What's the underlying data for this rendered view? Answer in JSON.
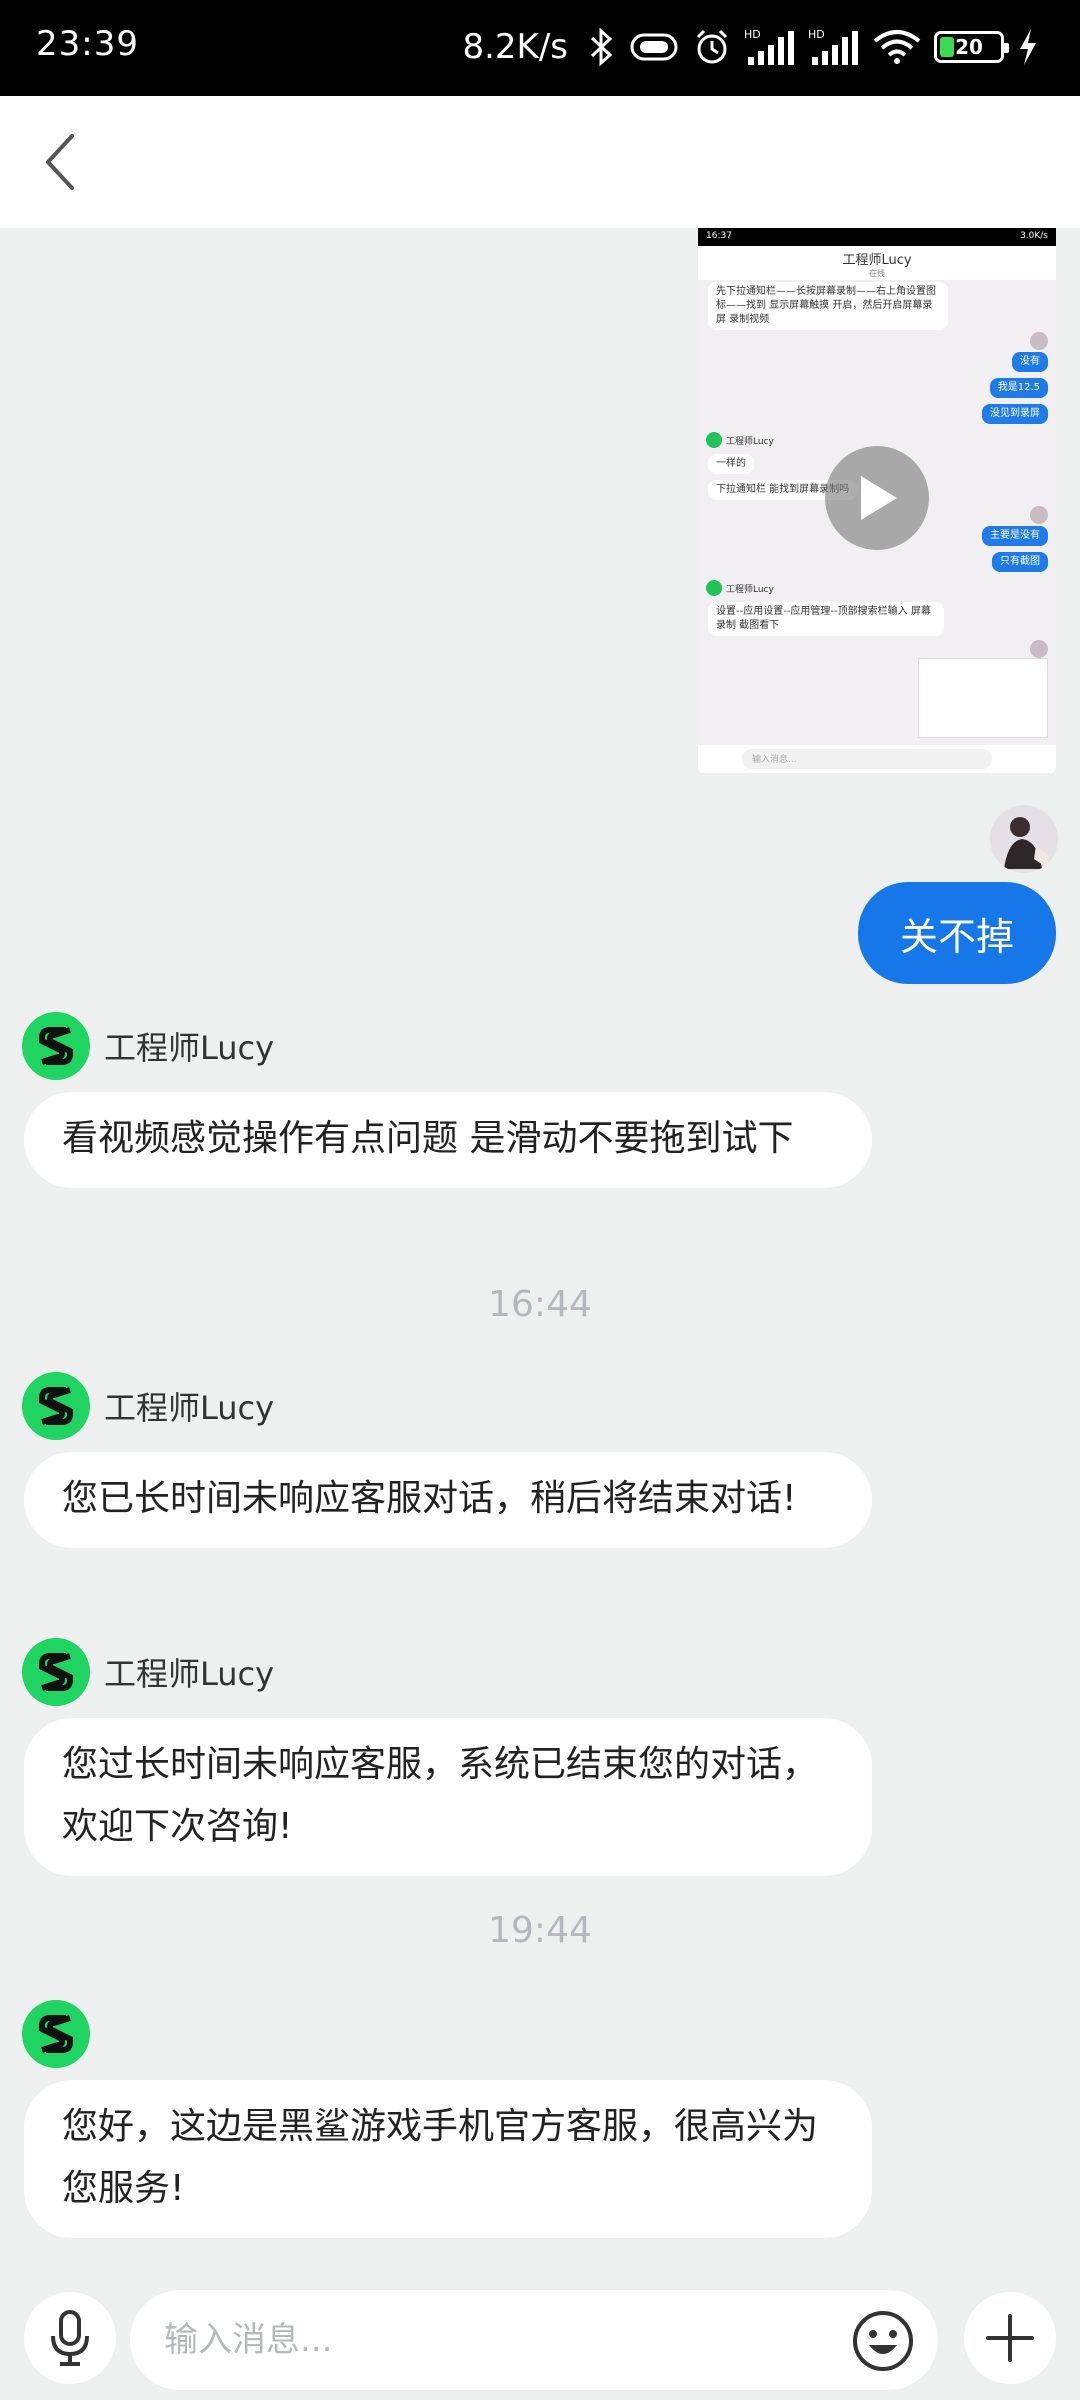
{
  "status_bar": {
    "time": "23:39",
    "net_speed": "8.2K/s",
    "battery": "20"
  },
  "video_preview": {
    "status_time": "16:37",
    "status_speed": "3.0K/s",
    "title": "工程师Lucy",
    "subtitle": "在线",
    "msg_intro": "先下拉通知栏——长按屏幕录制——右上角设置图标——找到 显示屏幕触摸 开启，然后开启屏幕录屏 录制视频",
    "reply_1": "没有",
    "reply_2": "我是12.5",
    "reply_3": "没见到录屏",
    "agent_name_1": "工程师Lucy",
    "agent_msg_1": "一样的",
    "agent_msg_2": "下拉通知栏  能找到屏幕录制吗",
    "reply_4": "主要是没有",
    "reply_5": "只有截图",
    "agent_name_2": "工程师Lucy",
    "agent_msg_3": "设置--应用设置--应用管理--顶部搜索栏输入 屏幕录制 截图看下",
    "input_placeholder": "输入消息..."
  },
  "messages": {
    "user_reply": "关不掉",
    "agent_name": "工程师Lucy",
    "msg_1": "看视频感觉操作有点问题   是滑动不要拖到试下",
    "time_1": "16:44",
    "msg_2": "您已长时间未响应客服对话，稍后将结束对话!",
    "msg_3": "您过长时间未响应客服，系统已结束您的对话，欢迎下次咨询!",
    "time_2": "19:44",
    "msg_4": "您好，这边是黑鲨游戏手机官方客服，很高兴为您服务!"
  },
  "input": {
    "placeholder": "输入消息..."
  },
  "colors": {
    "user_bubble": "#1678e8",
    "agent_avatar": "#1fd461",
    "background": "#eef0f0"
  },
  "icons": [
    "back-icon",
    "mic-icon",
    "emoji-icon",
    "plus-icon",
    "play-icon",
    "bluetooth-icon",
    "wifi-icon",
    "signal-icon",
    "alarm-icon",
    "battery-icon",
    "charging-icon"
  ]
}
